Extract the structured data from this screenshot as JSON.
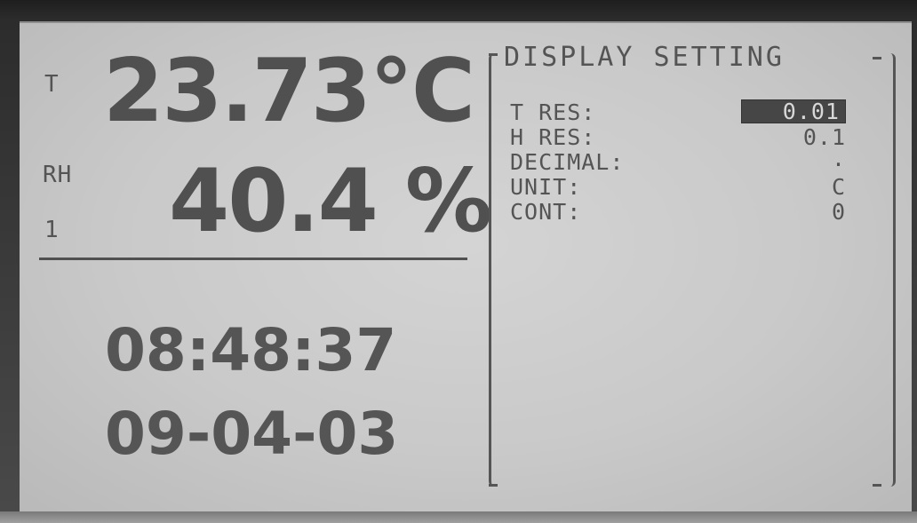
{
  "readings": {
    "temp_label": "T",
    "temp_value": "23.73°C",
    "rh_label": "RH",
    "rh_value": "40.4 %",
    "channel": "1"
  },
  "clock": {
    "time": "08:48:37",
    "date": "09-04-03"
  },
  "menu": {
    "title": "DISPLAY SETTING",
    "items": [
      {
        "label": "T RES:",
        "value": "0.01",
        "selected": true
      },
      {
        "label": "H RES:",
        "value": "0.1",
        "selected": false
      },
      {
        "label": "DECIMAL:",
        "value": ".",
        "selected": false
      },
      {
        "label": "UNIT:",
        "value": "C",
        "selected": false
      },
      {
        "label": "CONT:",
        "value": "0",
        "selected": false
      }
    ]
  },
  "colors": {
    "lcd_background": "#cfcfcf",
    "lcd_pixel": "#505050",
    "selection_background": "#464646"
  }
}
